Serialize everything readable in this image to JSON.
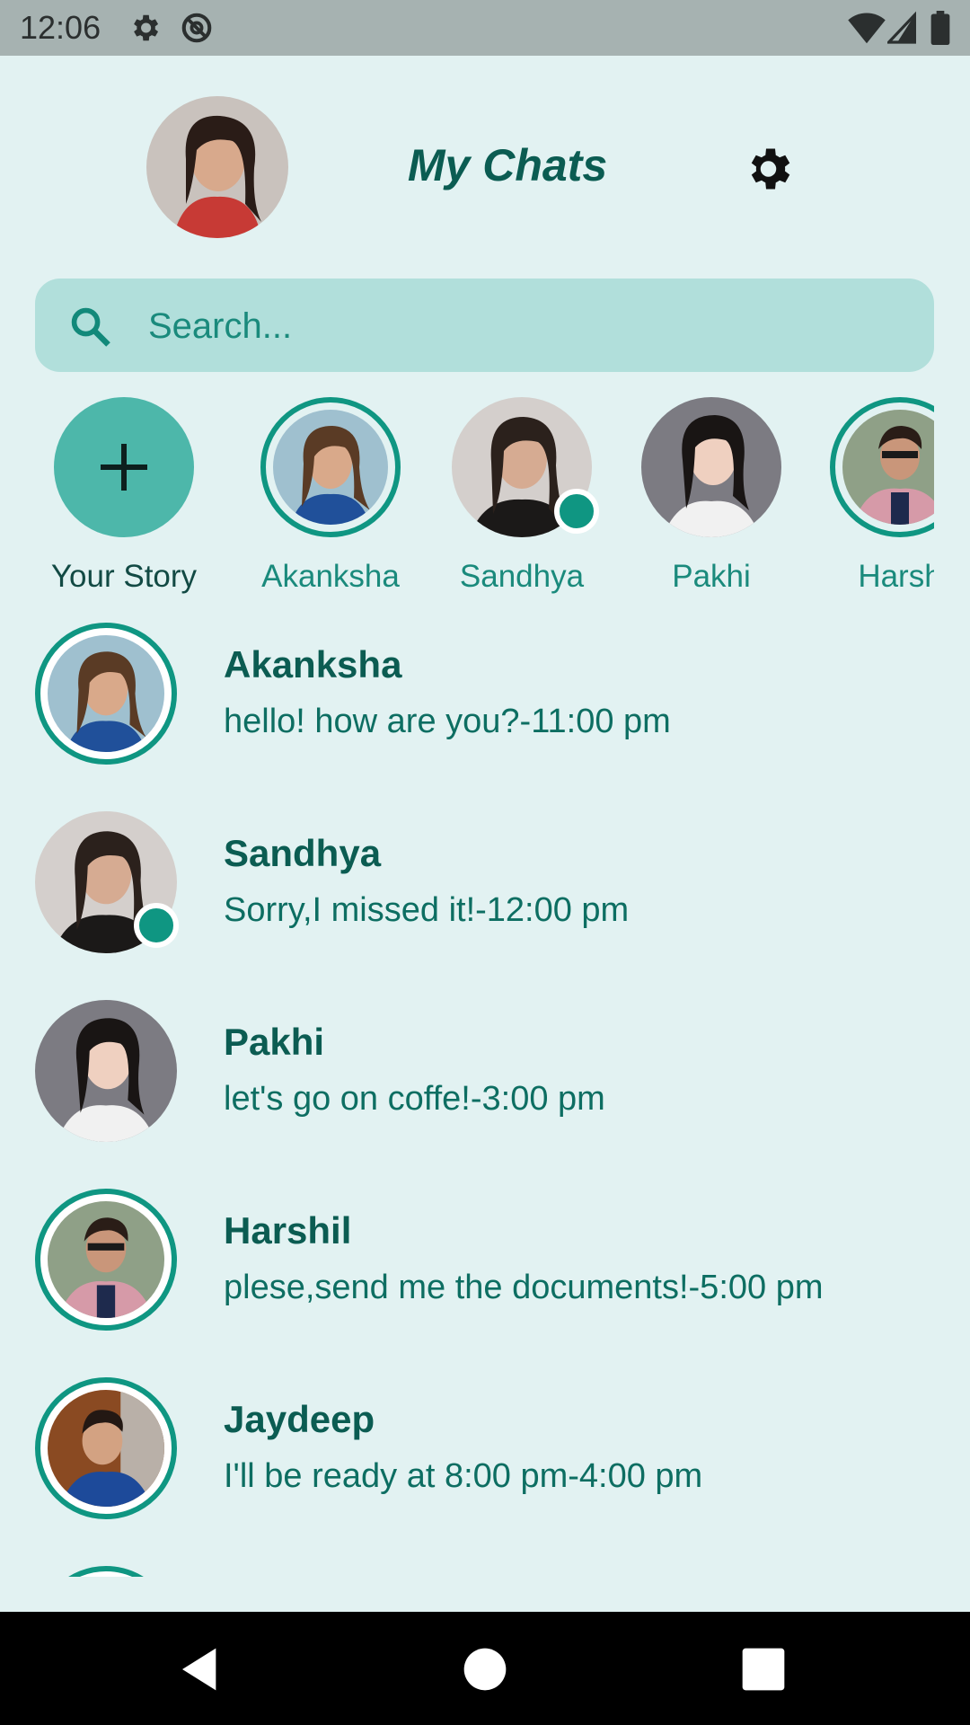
{
  "status_bar": {
    "time": "12:06"
  },
  "header": {
    "title": "My Chats"
  },
  "search": {
    "placeholder": "Search..."
  },
  "stories": [
    {
      "label": "Your Story"
    },
    {
      "label": "Akanksha"
    },
    {
      "label": "Sandhya"
    },
    {
      "label": "Pakhi"
    },
    {
      "label": "Harsh"
    }
  ],
  "chats": [
    {
      "name": "Akanksha",
      "message": "hello! how are you?-11:00 pm"
    },
    {
      "name": "Sandhya",
      "message": "Sorry,I missed it!-12:00 pm"
    },
    {
      "name": "Pakhi",
      "message": "let's go on coffe!-3:00 pm"
    },
    {
      "name": "Harshil",
      "message": "plese,send me the documents!-5:00 pm"
    },
    {
      "name": "Jaydeep",
      "message": "I'll be ready at 8:00 pm-4:00 pm"
    }
  ],
  "colors": {
    "background": "#e2f2f2",
    "accent": "#0f9682",
    "title": "#0b5c52",
    "search_bg": "#b1dfdb"
  }
}
